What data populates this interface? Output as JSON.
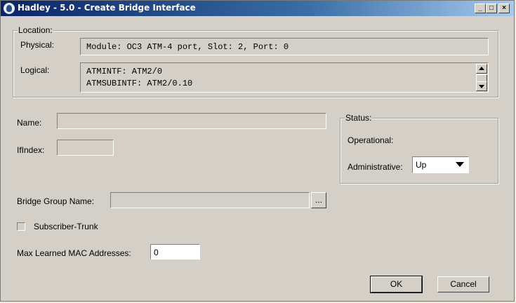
{
  "window": {
    "title": "Hadley - 5.0 - Create Bridge Interface",
    "controls": {
      "minimize": "_",
      "maximize": "□",
      "close": "×"
    }
  },
  "location": {
    "legend": "Location:",
    "physical_label": "Physical:",
    "physical_value": "Module: OC3 ATM-4 port, Slot: 2, Port: 0",
    "logical_label": "Logical:",
    "logical_lines": [
      "ATMINTF: ATM2/0",
      "ATMSUBINTF: ATM2/0.10"
    ]
  },
  "form": {
    "name_label": "Name:",
    "name_value": "",
    "ifindex_label": "IfIndex:",
    "ifindex_value": "",
    "bridge_group_label": "Bridge Group Name:",
    "bridge_group_value": "",
    "browse_label": "...",
    "subscriber_trunk_label": "Subscriber-Trunk",
    "subscriber_trunk_checked": false,
    "max_mac_label": "Max Learned MAC Addresses:",
    "max_mac_value": "0"
  },
  "status": {
    "legend": "Status:",
    "operational_label": "Operational:",
    "operational_value": "",
    "administrative_label": "Administrative:",
    "administrative_value": "Up"
  },
  "buttons": {
    "ok": "OK",
    "cancel": "Cancel"
  }
}
